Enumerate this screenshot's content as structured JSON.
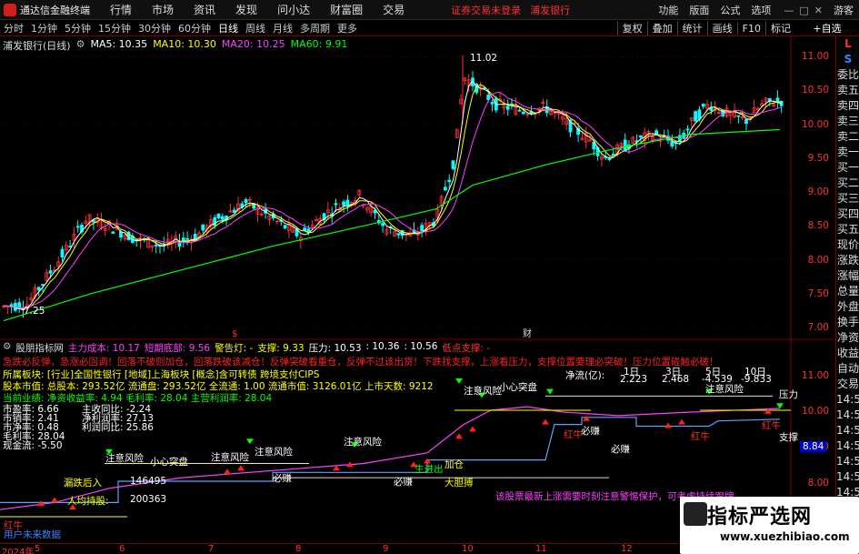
{
  "menubar": {
    "app_title": "通达信金融终端",
    "items": [
      "行情",
      "市场",
      "资讯",
      "发现",
      "问小达",
      "财富圈",
      "交易"
    ],
    "status": "证券交易未登录",
    "broker": "浦发银行",
    "right_items": [
      "功能",
      "版面",
      "公式",
      "选项"
    ],
    "guest": "游客"
  },
  "toolbar": {
    "periods": [
      "分时",
      "1分钟",
      "5分钟",
      "15分钟",
      "30分钟",
      "60分钟",
      "日线",
      "周线",
      "月线",
      "多周期",
      "更多"
    ],
    "active_period": "日线",
    "tools": [
      "复权",
      "叠加",
      "统计",
      "画线",
      "F10",
      "标记"
    ],
    "zixuan": "+自选"
  },
  "legend": {
    "stock": "浦发银行(日线)",
    "ma5": "MA5: 10.35",
    "ma10": "MA10: 10.30",
    "ma20": "MA20: 10.25",
    "ma60": "MA60: 9.91"
  },
  "colors": {
    "up": "#ff3030",
    "down": "#00ffff",
    "ma5": "#ffffff",
    "ma10": "#ffff00",
    "ma20": "#ff40ff",
    "ma60": "#00ff00"
  },
  "price_axis": {
    "ticks": [
      "11.00",
      "10.50",
      "10.00",
      "9.50",
      "9.00",
      "8.50",
      "8.00",
      "7.50",
      "7.00"
    ],
    "high_label": "11.02",
    "low_label": "7.25"
  },
  "indicator": {
    "name": "股朋指标网",
    "zhuli": "主力成本: 10.17",
    "duanqi": "短期底部: 9.56",
    "jingao": "警告灯: -",
    "zhicheng": "支撑: 9.33",
    "yali": "压力: 10.53",
    "v1": ": 10.36",
    "v2": ": 10.56",
    "didian": "低点支撑: -",
    "warn_text": "急跌必反弹，急涨必回调！回落不破则加仓，回落跌破该减仓！反弹突破看重仓，反弹不过该出货！下跌找支撑，上涨看压力，支撑位置要理必突破！压力位置碰触必破！",
    "bankuai": "所属板块: [行业]全国性银行 [地域]上海板块 [概念]含可转债 跨境支付CIPS",
    "guben": "股本市值: 总股本: 293.52亿 流通盘: 293.52亿 全流通: 1.00 流通市值: 3126.01亿 上市天数: 9212",
    "yeji": "当前业绩: 净资收益率: 4.94 毛利率: 28.04 主营利润率: 28.04",
    "fin_left": [
      "市盈率: 6.66",
      "市销率: 2.41",
      "市净率: 0.48",
      "毛利率: 28.04",
      "现金流: -5.50"
    ],
    "fin_right": [
      "主收同比: -2.24",
      "净利润率: 27.13",
      "利润同比: 25.86"
    ],
    "jingliu": "净流(亿):",
    "jl_headers": [
      "1日",
      "3日",
      "5日",
      "10日"
    ],
    "jl_values": [
      "2.223",
      "2.468",
      "-4.539",
      "-9.833"
    ],
    "axis_ticks": [
      "11.00",
      "10.00",
      "9.00",
      "8.00"
    ],
    "val_8_84": "8.84",
    "labels": {
      "zhuyi": "注意风险",
      "xiaoxin": "小心突盘",
      "yali": "压力",
      "zhicheng": "支撑",
      "bizhuan": "必赚",
      "hongniu": "红牛",
      "renqi": "人均持股:",
      "renqi_val": "200363",
      "num1": "146495",
      "dadan": "大胆搏",
      "jiacang": "加仓",
      "shengzhang": "生进出",
      "chuxian": "漏跌后入",
      "bottom_pink": "该股票最新上涨需要时刻注意警惕保护，可考虑持续跟牌",
      "bottom_left": "用户未来数据",
      "hong": "红牛"
    }
  },
  "xaxis": {
    "labels": [
      "2024年",
      "5",
      "6",
      "7",
      "8",
      "9",
      "10",
      "11",
      "12"
    ]
  },
  "right_panel": [
    "L",
    "S",
    "委比",
    "卖五",
    "卖四",
    "卖三",
    "卖二",
    "卖一",
    "买一",
    "买二",
    "买三",
    "买四",
    "买五",
    "现价",
    "涨跌",
    "涨幅",
    "总量",
    "外盘",
    "换手",
    "净资",
    "收益",
    "自动",
    "交易",
    "14:56",
    "14:56",
    "14:56",
    "14:56",
    "14:56",
    "14:56",
    "14:56",
    "14:56"
  ],
  "watermark": {
    "title": "指标严选网",
    "url": "www.xuezhibiao.com"
  }
}
